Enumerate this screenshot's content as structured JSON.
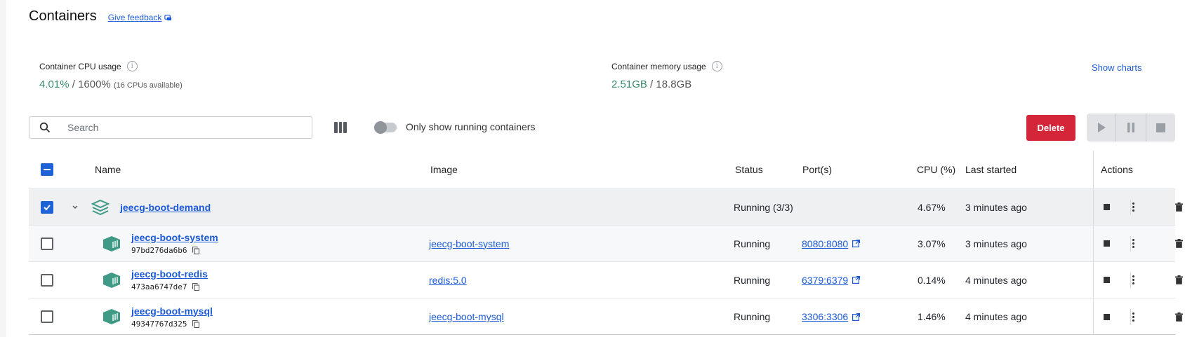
{
  "header": {
    "title": "Containers",
    "feedback_label": "Give feedback"
  },
  "stats": {
    "cpu_label": "Container CPU usage",
    "cpu_used": "4.01%",
    "cpu_sep": " / ",
    "cpu_total": "1600%",
    "cpu_note": "(16 CPUs available)",
    "mem_label": "Container memory usage",
    "mem_used": "2.51GB",
    "mem_sep": " / ",
    "mem_total": "18.8GB",
    "show_charts": "Show charts"
  },
  "toolbar": {
    "search_placeholder": "Search",
    "toggle_label": "Only show running containers",
    "toggle_on": false,
    "delete_label": "Delete"
  },
  "table": {
    "headers": {
      "name": "Name",
      "image": "Image",
      "status": "Status",
      "ports": "Port(s)",
      "cpu": "CPU (%)",
      "last_started": "Last started",
      "actions": "Actions"
    },
    "group": {
      "name": "jeecg-boot-demand",
      "status": "Running (3/3)",
      "cpu": "4.67%",
      "last_started": "3 minutes ago",
      "checked": true
    },
    "rows": [
      {
        "name": "jeecg-boot-system",
        "id": "97bd276da6b6",
        "image": "jeecg-boot-system",
        "status": "Running",
        "port": "8080:8080",
        "cpu": "3.07%",
        "last_started": "3 minutes ago"
      },
      {
        "name": "jeecg-boot-redis",
        "id": "473aa6747de7",
        "image": "redis:5.0",
        "status": "Running",
        "port": "6379:6379",
        "cpu": "0.14%",
        "last_started": "4 minutes ago"
      },
      {
        "name": "jeecg-boot-mysql",
        "id": "49347767d325",
        "image": "jeecg-boot-mysql",
        "status": "Running",
        "port": "3306:3306",
        "cpu": "1.46%",
        "last_started": "4 minutes ago"
      }
    ]
  },
  "colors": {
    "accent": "#1d5bd6",
    "danger": "#d32639",
    "stat_green": "#3a8a6b",
    "container_icon": "#3f9a86"
  }
}
